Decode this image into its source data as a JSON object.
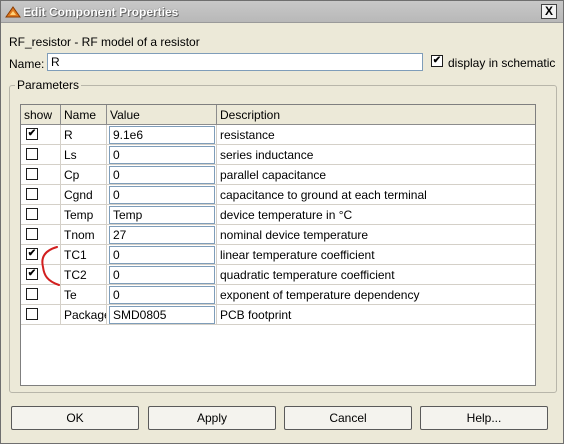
{
  "window": {
    "title": "Edit Component Properties",
    "close_glyph": "X"
  },
  "component": {
    "subtitle": "RF_resistor - RF model of a resistor"
  },
  "name_field": {
    "label": "Name:",
    "value": "R",
    "display_label": "display in schematic",
    "display_checked": true
  },
  "parameters": {
    "group_label": "Parameters",
    "headers": [
      "show",
      "Name",
      "Value",
      "Description"
    ],
    "rows": [
      {
        "show": true,
        "name": "R",
        "value": "9.1e6",
        "description": "resistance"
      },
      {
        "show": false,
        "name": "Ls",
        "value": "0",
        "description": "series inductance"
      },
      {
        "show": false,
        "name": "Cp",
        "value": "0",
        "description": "parallel capacitance"
      },
      {
        "show": false,
        "name": "Cgnd",
        "value": "0",
        "description": "capacitance to ground at each terminal"
      },
      {
        "show": false,
        "name": "Temp",
        "value": "Temp",
        "description": "device temperature in °C"
      },
      {
        "show": false,
        "name": "Tnom",
        "value": "27",
        "description": "nominal device temperature"
      },
      {
        "show": true,
        "name": "TC1",
        "value": "0",
        "description": "linear temperature coefficient"
      },
      {
        "show": true,
        "name": "TC2",
        "value": "0",
        "description": "quadratic temperature coefficient"
      },
      {
        "show": false,
        "name": "Te",
        "value": "0",
        "description": "exponent of temperature dependency"
      },
      {
        "show": false,
        "name": "Package",
        "value": "SMD0805",
        "description": "PCB footprint"
      }
    ]
  },
  "buttons": {
    "ok": "OK",
    "apply": "Apply",
    "cancel": "Cancel",
    "help": "Help..."
  },
  "colors": {
    "annotation_red": "#d21f1f",
    "window_bg": "#ece9d8"
  },
  "icons": {
    "app": "qucs-app-icon",
    "close": "close-icon",
    "check": "check-mark-icon"
  }
}
